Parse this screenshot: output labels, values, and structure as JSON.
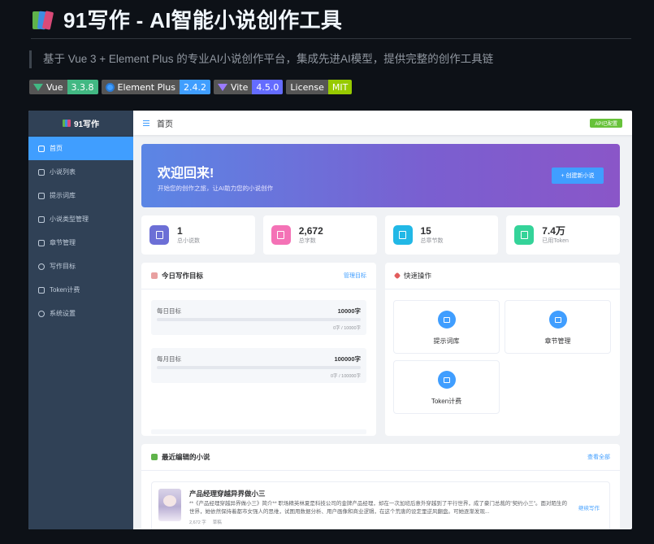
{
  "readme": {
    "title": "91写作 - AI智能小说创作工具",
    "description": "基于 Vue 3 + Element Plus 的专业AI小说创作平台，集成先进AI模型，提供完整的创作工具链",
    "badges": [
      {
        "label": "Vue",
        "value": "3.3.8",
        "color": "#42b883",
        "icon": "vue-icon"
      },
      {
        "label": "Element Plus",
        "value": "2.4.2",
        "color": "#409eff",
        "icon": "element-plus-icon"
      },
      {
        "label": "Vite",
        "value": "4.5.0",
        "color": "#646cff",
        "icon": "vite-icon"
      },
      {
        "label": "License",
        "value": "MIT",
        "color": "#97ca00"
      }
    ]
  },
  "app": {
    "brand": "91写作",
    "menu": [
      {
        "label": "首页",
        "icon": "home-icon",
        "active": true
      },
      {
        "label": "小说列表",
        "icon": "document-icon"
      },
      {
        "label": "提示词库",
        "icon": "chat-icon"
      },
      {
        "label": "小说类型管理",
        "icon": "folder-icon"
      },
      {
        "label": "章节管理",
        "icon": "notebook-icon"
      },
      {
        "label": "写作目标",
        "icon": "target-icon"
      },
      {
        "label": "Token计费",
        "icon": "wallet-icon"
      },
      {
        "label": "系统设置",
        "icon": "gear-icon"
      }
    ],
    "breadcrumb": "首页",
    "api_status": "API已配置",
    "welcome": {
      "title": "欢迎回来!",
      "subtitle": "开始您的创作之旅，让AI助力您的小说创作",
      "button": "+ 创建新小说"
    },
    "stats": [
      {
        "value": "1",
        "label": "总小说数",
        "color": "#6c6fd6"
      },
      {
        "value": "2,672",
        "label": "总字数",
        "color": "#f472b6"
      },
      {
        "value": "15",
        "label": "总章节数",
        "color": "#22b8e6"
      },
      {
        "value": "7.4万",
        "label": "已用Token",
        "color": "#34d399"
      }
    ],
    "goals": {
      "title": "今日写作目标",
      "manage": "管理目标",
      "items": [
        {
          "label": "每日目标",
          "target": "10000字",
          "progress_text": "0字 / 10000字",
          "progress": 0
        },
        {
          "label": "每月目标",
          "target": "100000字",
          "progress_text": "0字 / 100000字",
          "progress": 0
        }
      ]
    },
    "quick": {
      "title": "快速操作",
      "items": [
        {
          "label": "提示词库",
          "icon": "chat-icon"
        },
        {
          "label": "章节管理",
          "icon": "notebook-icon"
        },
        {
          "label": "Token计费",
          "icon": "wallet-icon"
        }
      ]
    },
    "recent": {
      "title": "最近编辑的小说",
      "view_all": "查看全部",
      "novel": {
        "title": "产品经理穿越异界做小三",
        "description": "**《产品经理穿越异界做小三》简介** 职场精英林夏是科技公司的金牌产品经理，却在一次加班后意外穿越到了平行世界，成了豪门总裁的\"契约小三\"。面对陌生的世界，她依然保持着都市女强人的思维，试图用数据分析、用户画像和商业逻辑，在这个荒唐的设定里逆风翻盘。可她逐渐发现...",
        "words": "2,672 字",
        "status": "草稿",
        "action": "继续写作"
      }
    }
  }
}
